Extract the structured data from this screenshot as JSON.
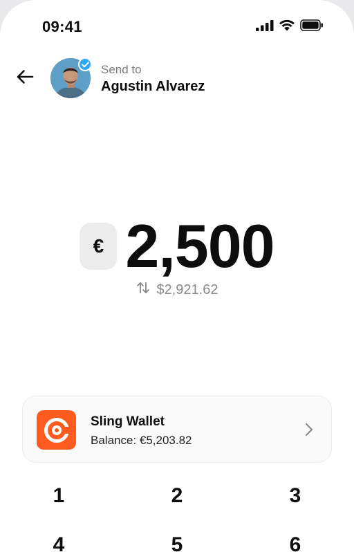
{
  "status_bar": {
    "time": "09:41",
    "icons": [
      "signal-icon",
      "wifi-icon",
      "battery-icon"
    ]
  },
  "header": {
    "back_icon": "arrow-left-icon",
    "label": "Send to",
    "recipient_name": "Agustin Alvarez",
    "verified": true
  },
  "amount": {
    "currency_symbol": "€",
    "value": "2,500",
    "swap_icon": "swap-vertical-icon",
    "converted": "$2,921.62"
  },
  "wallet": {
    "name": "Sling Wallet",
    "balance": "Balance: €5,203.82",
    "brand_color": "#ff5a1f"
  },
  "keypad": {
    "keys": [
      "1",
      "2",
      "3",
      "4",
      "5",
      "6"
    ]
  },
  "colors": {
    "accent_verified": "#2fa8f4",
    "muted_text": "#7a7a7a"
  }
}
